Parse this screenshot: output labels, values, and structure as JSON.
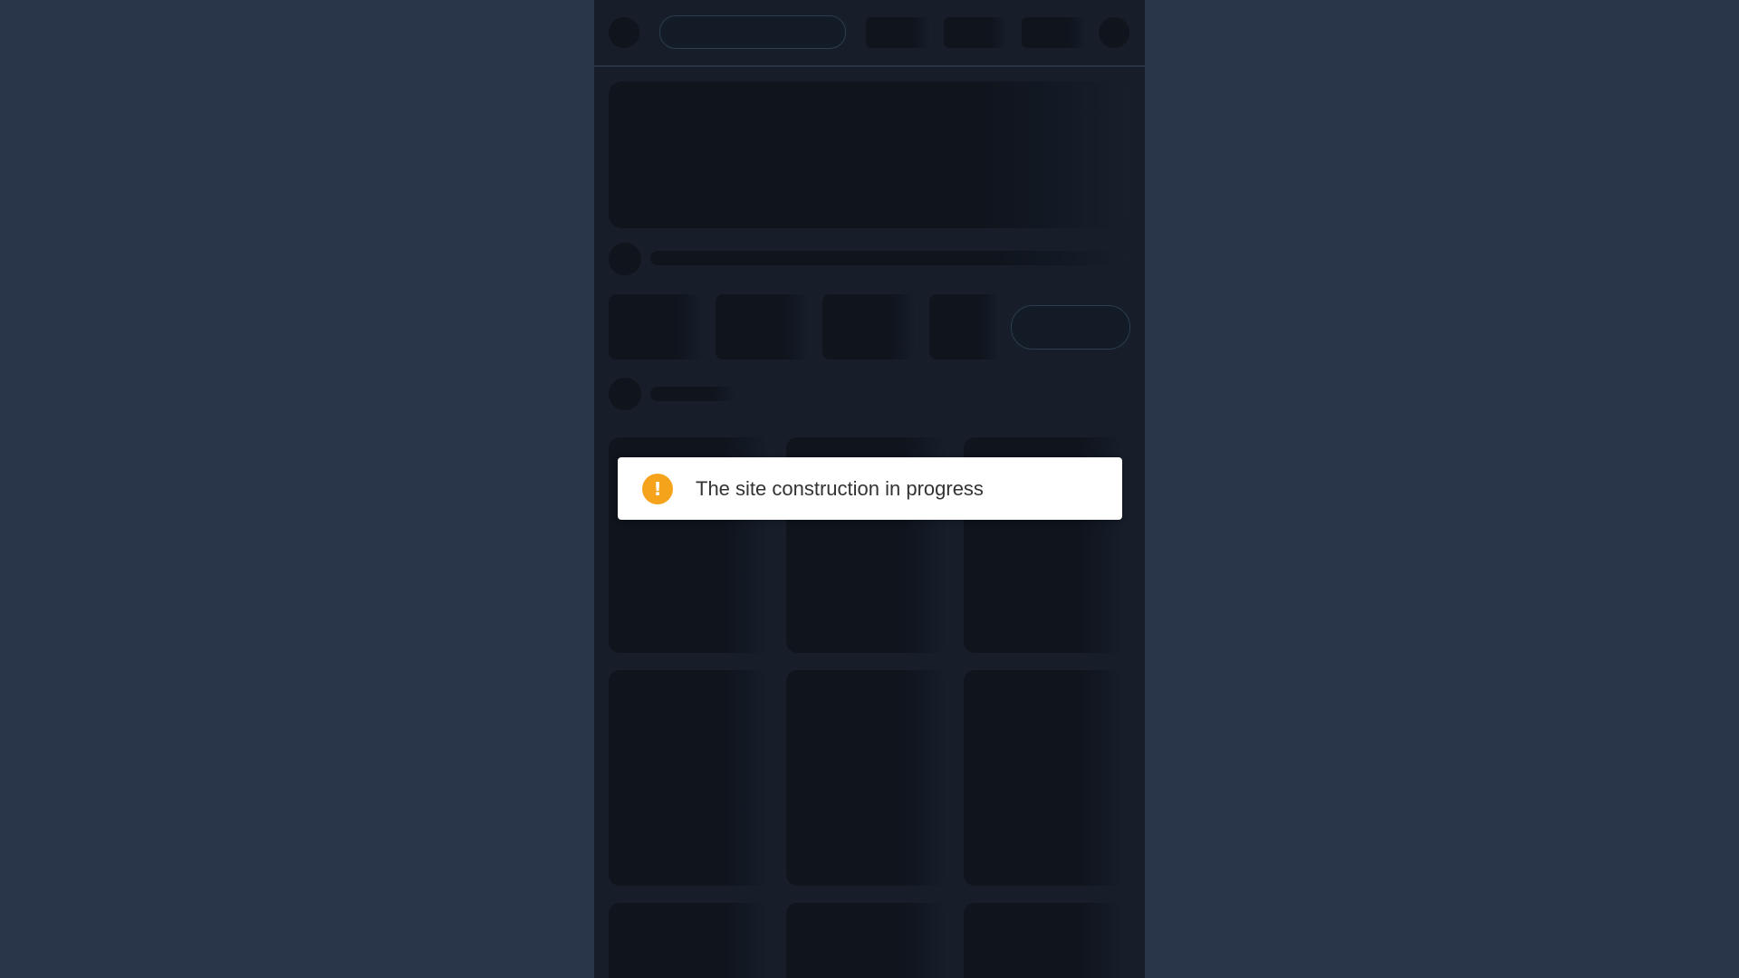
{
  "notification": {
    "type": "warning",
    "icon": "exclamation-icon",
    "icon_glyph": "!",
    "message": "The site construction in progress",
    "accent_color": "#f5a31a"
  },
  "page": {
    "state": "loading-skeleton",
    "background_color": "#293548",
    "panel_color": "#171e29"
  }
}
